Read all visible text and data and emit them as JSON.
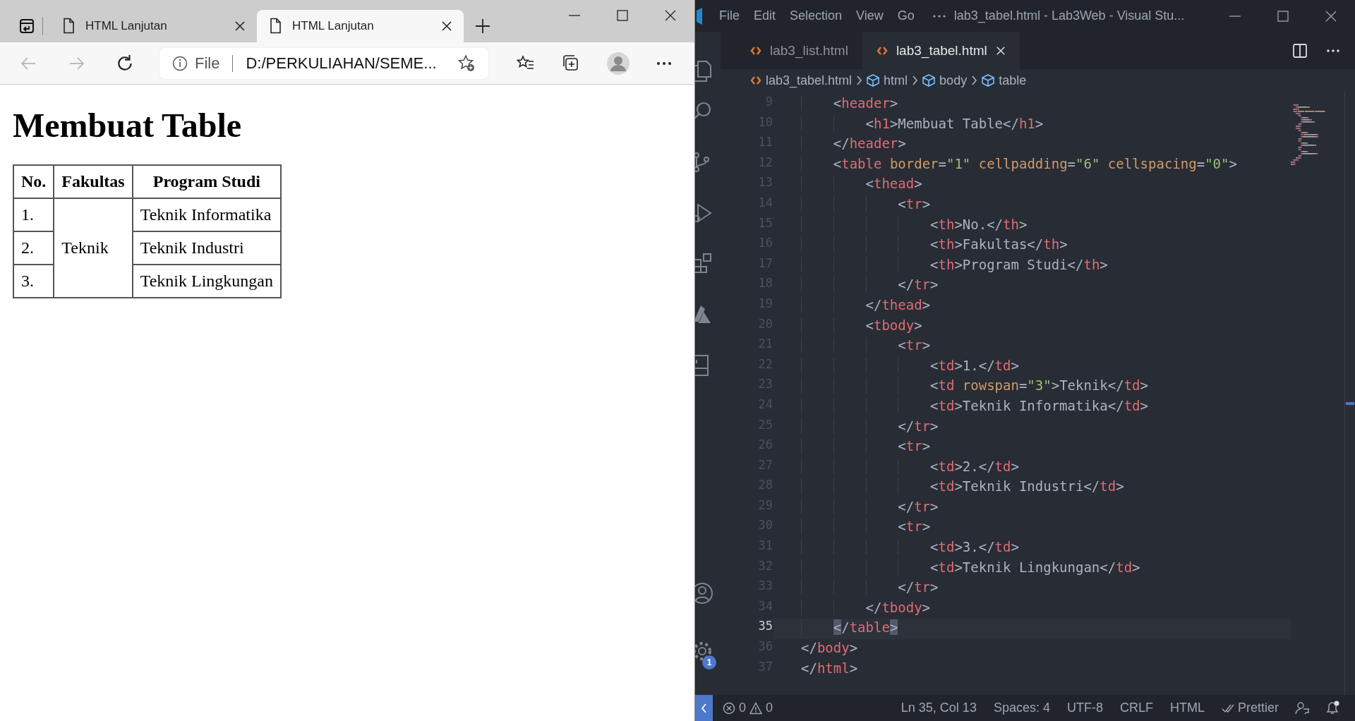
{
  "browser": {
    "tabs": [
      {
        "title": "HTML Lanjutan",
        "selected": false
      },
      {
        "title": "HTML Lanjutan",
        "selected": true
      }
    ],
    "address": {
      "scheme": "File",
      "url": "D:/PERKULIAHAN/SEME..."
    },
    "page": {
      "heading": "Membuat Table",
      "table": {
        "columns": [
          "No.",
          "Fakultas",
          "Program Studi"
        ],
        "groups": [
          {
            "fakultas": "Teknik",
            "rows": [
              {
                "no": "1.",
                "program": "Teknik Informatika"
              },
              {
                "no": "2.",
                "program": "Teknik Industri"
              },
              {
                "no": "3.",
                "program": "Teknik Lingkungan"
              }
            ]
          }
        ]
      }
    }
  },
  "editor": {
    "menu": [
      "File",
      "Edit",
      "Selection",
      "View",
      "Go"
    ],
    "title": "lab3_tabel.html - Lab3Web - Visual Stu...",
    "tabs": [
      {
        "title": "lab3_list.html",
        "selected": false
      },
      {
        "title": "lab3_tabel.html",
        "selected": true
      }
    ],
    "breadcrumb": [
      {
        "kind": "file",
        "text": "lab3_tabel.html"
      },
      {
        "kind": "element",
        "text": "html"
      },
      {
        "kind": "element",
        "text": "body"
      },
      {
        "kind": "element",
        "text": "table"
      }
    ],
    "settings_badge": "1",
    "lines": [
      {
        "n": "9",
        "active": false,
        "code": "    <header>"
      },
      {
        "n": "10",
        "active": false,
        "code": "        <h1>Membuat Table</h1>"
      },
      {
        "n": "11",
        "active": false,
        "code": "    </header>"
      },
      {
        "n": "12",
        "active": false,
        "code": "    <table border=\"1\" cellpadding=\"6\" cellspacing=\"0\">"
      },
      {
        "n": "13",
        "active": false,
        "code": "        <thead>"
      },
      {
        "n": "14",
        "active": false,
        "code": "            <tr>"
      },
      {
        "n": "15",
        "active": false,
        "code": "                <th>No.</th>"
      },
      {
        "n": "16",
        "active": false,
        "code": "                <th>Fakultas</th>"
      },
      {
        "n": "17",
        "active": false,
        "code": "                <th>Program Studi</th>"
      },
      {
        "n": "18",
        "active": false,
        "code": "            </tr>"
      },
      {
        "n": "19",
        "active": false,
        "code": "        </thead>"
      },
      {
        "n": "20",
        "active": false,
        "code": "        <tbody>"
      },
      {
        "n": "21",
        "active": false,
        "code": "            <tr>"
      },
      {
        "n": "22",
        "active": false,
        "code": "                <td>1.</td>"
      },
      {
        "n": "23",
        "active": false,
        "code": "                <td rowspan=\"3\">Teknik</td>"
      },
      {
        "n": "24",
        "active": false,
        "code": "                <td>Teknik Informatika</td>"
      },
      {
        "n": "25",
        "active": false,
        "code": "            </tr>"
      },
      {
        "n": "26",
        "active": false,
        "code": "            <tr>"
      },
      {
        "n": "27",
        "active": false,
        "code": "                <td>2.</td>"
      },
      {
        "n": "28",
        "active": false,
        "code": "                <td>Teknik Industri</td>"
      },
      {
        "n": "29",
        "active": false,
        "code": "            </tr>"
      },
      {
        "n": "30",
        "active": false,
        "code": "            <tr>"
      },
      {
        "n": "31",
        "active": false,
        "code": "                <td>3.</td>"
      },
      {
        "n": "32",
        "active": false,
        "code": "                <td>Teknik Lingkungan</td>"
      },
      {
        "n": "33",
        "active": false,
        "code": "            </tr>"
      },
      {
        "n": "34",
        "active": false,
        "code": "        </tbody>"
      },
      {
        "n": "35",
        "active": true,
        "code": "    </table>"
      },
      {
        "n": "36",
        "active": false,
        "code": "</body>"
      },
      {
        "n": "37",
        "active": false,
        "code": "</html>"
      }
    ],
    "status": {
      "errors": "0",
      "warnings": "0",
      "items": [
        {
          "kind": "text",
          "text": "Ln 35, Col 13"
        },
        {
          "kind": "text",
          "text": "Spaces: 4"
        },
        {
          "kind": "text",
          "text": "UTF-8"
        },
        {
          "kind": "text",
          "text": "CRLF"
        },
        {
          "kind": "text",
          "text": "HTML"
        },
        {
          "kind": "check",
          "text": "Prettier"
        }
      ]
    }
  }
}
